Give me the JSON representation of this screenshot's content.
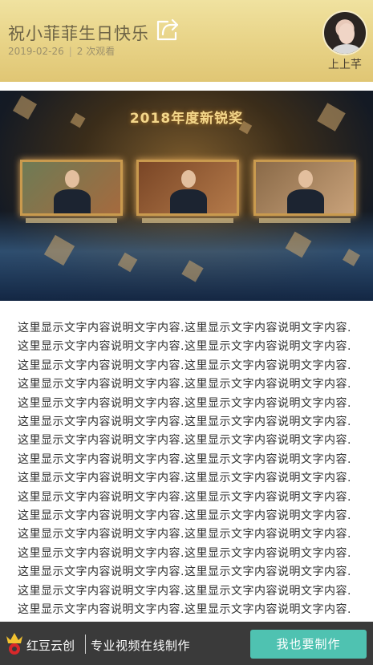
{
  "header": {
    "title": "祝小菲菲生日快乐",
    "date": "2019-02-26",
    "views": "2 次观看",
    "author": "上上芊"
  },
  "banner": {
    "title": "2018年度新锐奖"
  },
  "content": {
    "text": "这里显示文字内容说明文字内容.这里显示文字内容说明文字内容.这里显示文字内容说明文字内容.这里显示文字内容说明文字内容.这里显示文字内容说明文字内容.这里显示文字内容说明文字内容.这里显示文字内容说明文字内容.这里显示文字内容说明文字内容.这里显示文字内容说明文字内容.这里显示文字内容说明文字内容.这里显示文字内容说明文字内容.这里显示文字内容说明文字内容.这里显示文字内容说明文字内容.这里显示文字内容说明文字内容.这里显示文字内容说明文字内容.这里显示文字内容说明文字内容.这里显示文字内容说明文字内容.这里显示文字内容说明文字内容.这里显示文字内容说明文字内容.这里显示文字内容说明文字内容.这里显示文字内容说明文字内容.这里显示文字内容说明文字内容.这里显示文字内容说明文字内容.这里显示文字内容说明文字内容.这里显示文字内容说明文字内容.这里显示文字内容说明文字内容.这里显示文字内容说明文字内容.这里显示文字内容说明文字内容.这里显示文字内容说明文字内容.这里显示文字内容说明文字内容.这里显示文字内容说明文字内容.这里显示文字内容说明文字内容.这里显示文字内容说明文字内容."
  },
  "footer": {
    "brand": "红豆云创",
    "slogan": "专业视频在线制作",
    "cta_label": "我也要制作"
  },
  "colors": {
    "header_gold": "#e9d58a",
    "cta_teal": "#4fc2b1",
    "footer_bg": "#3a3a3a"
  },
  "icons": {
    "share": "share-icon",
    "logo": "crown-logo-icon"
  }
}
